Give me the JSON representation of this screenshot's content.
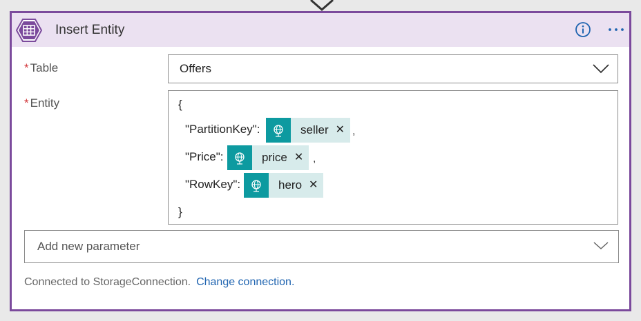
{
  "card": {
    "title": "Insert Entity",
    "icon": "table-storage-icon",
    "accent_color": "#7b4a9c",
    "header_bg": "#ebe1f1"
  },
  "fields": {
    "table": {
      "required_marker": "*",
      "label": "Table",
      "value": "Offers"
    },
    "entity": {
      "required_marker": "*",
      "label": "Entity",
      "open_brace": "{",
      "close_brace": "}",
      "rows": [
        {
          "key": "\"PartitionKey\":",
          "token": "seller",
          "comma": ","
        },
        {
          "key": "\"Price\":",
          "token": "price",
          "comma": ","
        },
        {
          "key": "\"RowKey\":",
          "token": "hero",
          "comma": ""
        }
      ],
      "token_color": "#0d9aa0",
      "token_bg": "#d7ebeb"
    }
  },
  "add_parameter": {
    "label": "Add new parameter"
  },
  "footer": {
    "connection_text": "Connected to StorageConnection.",
    "change_link": "Change connection."
  }
}
